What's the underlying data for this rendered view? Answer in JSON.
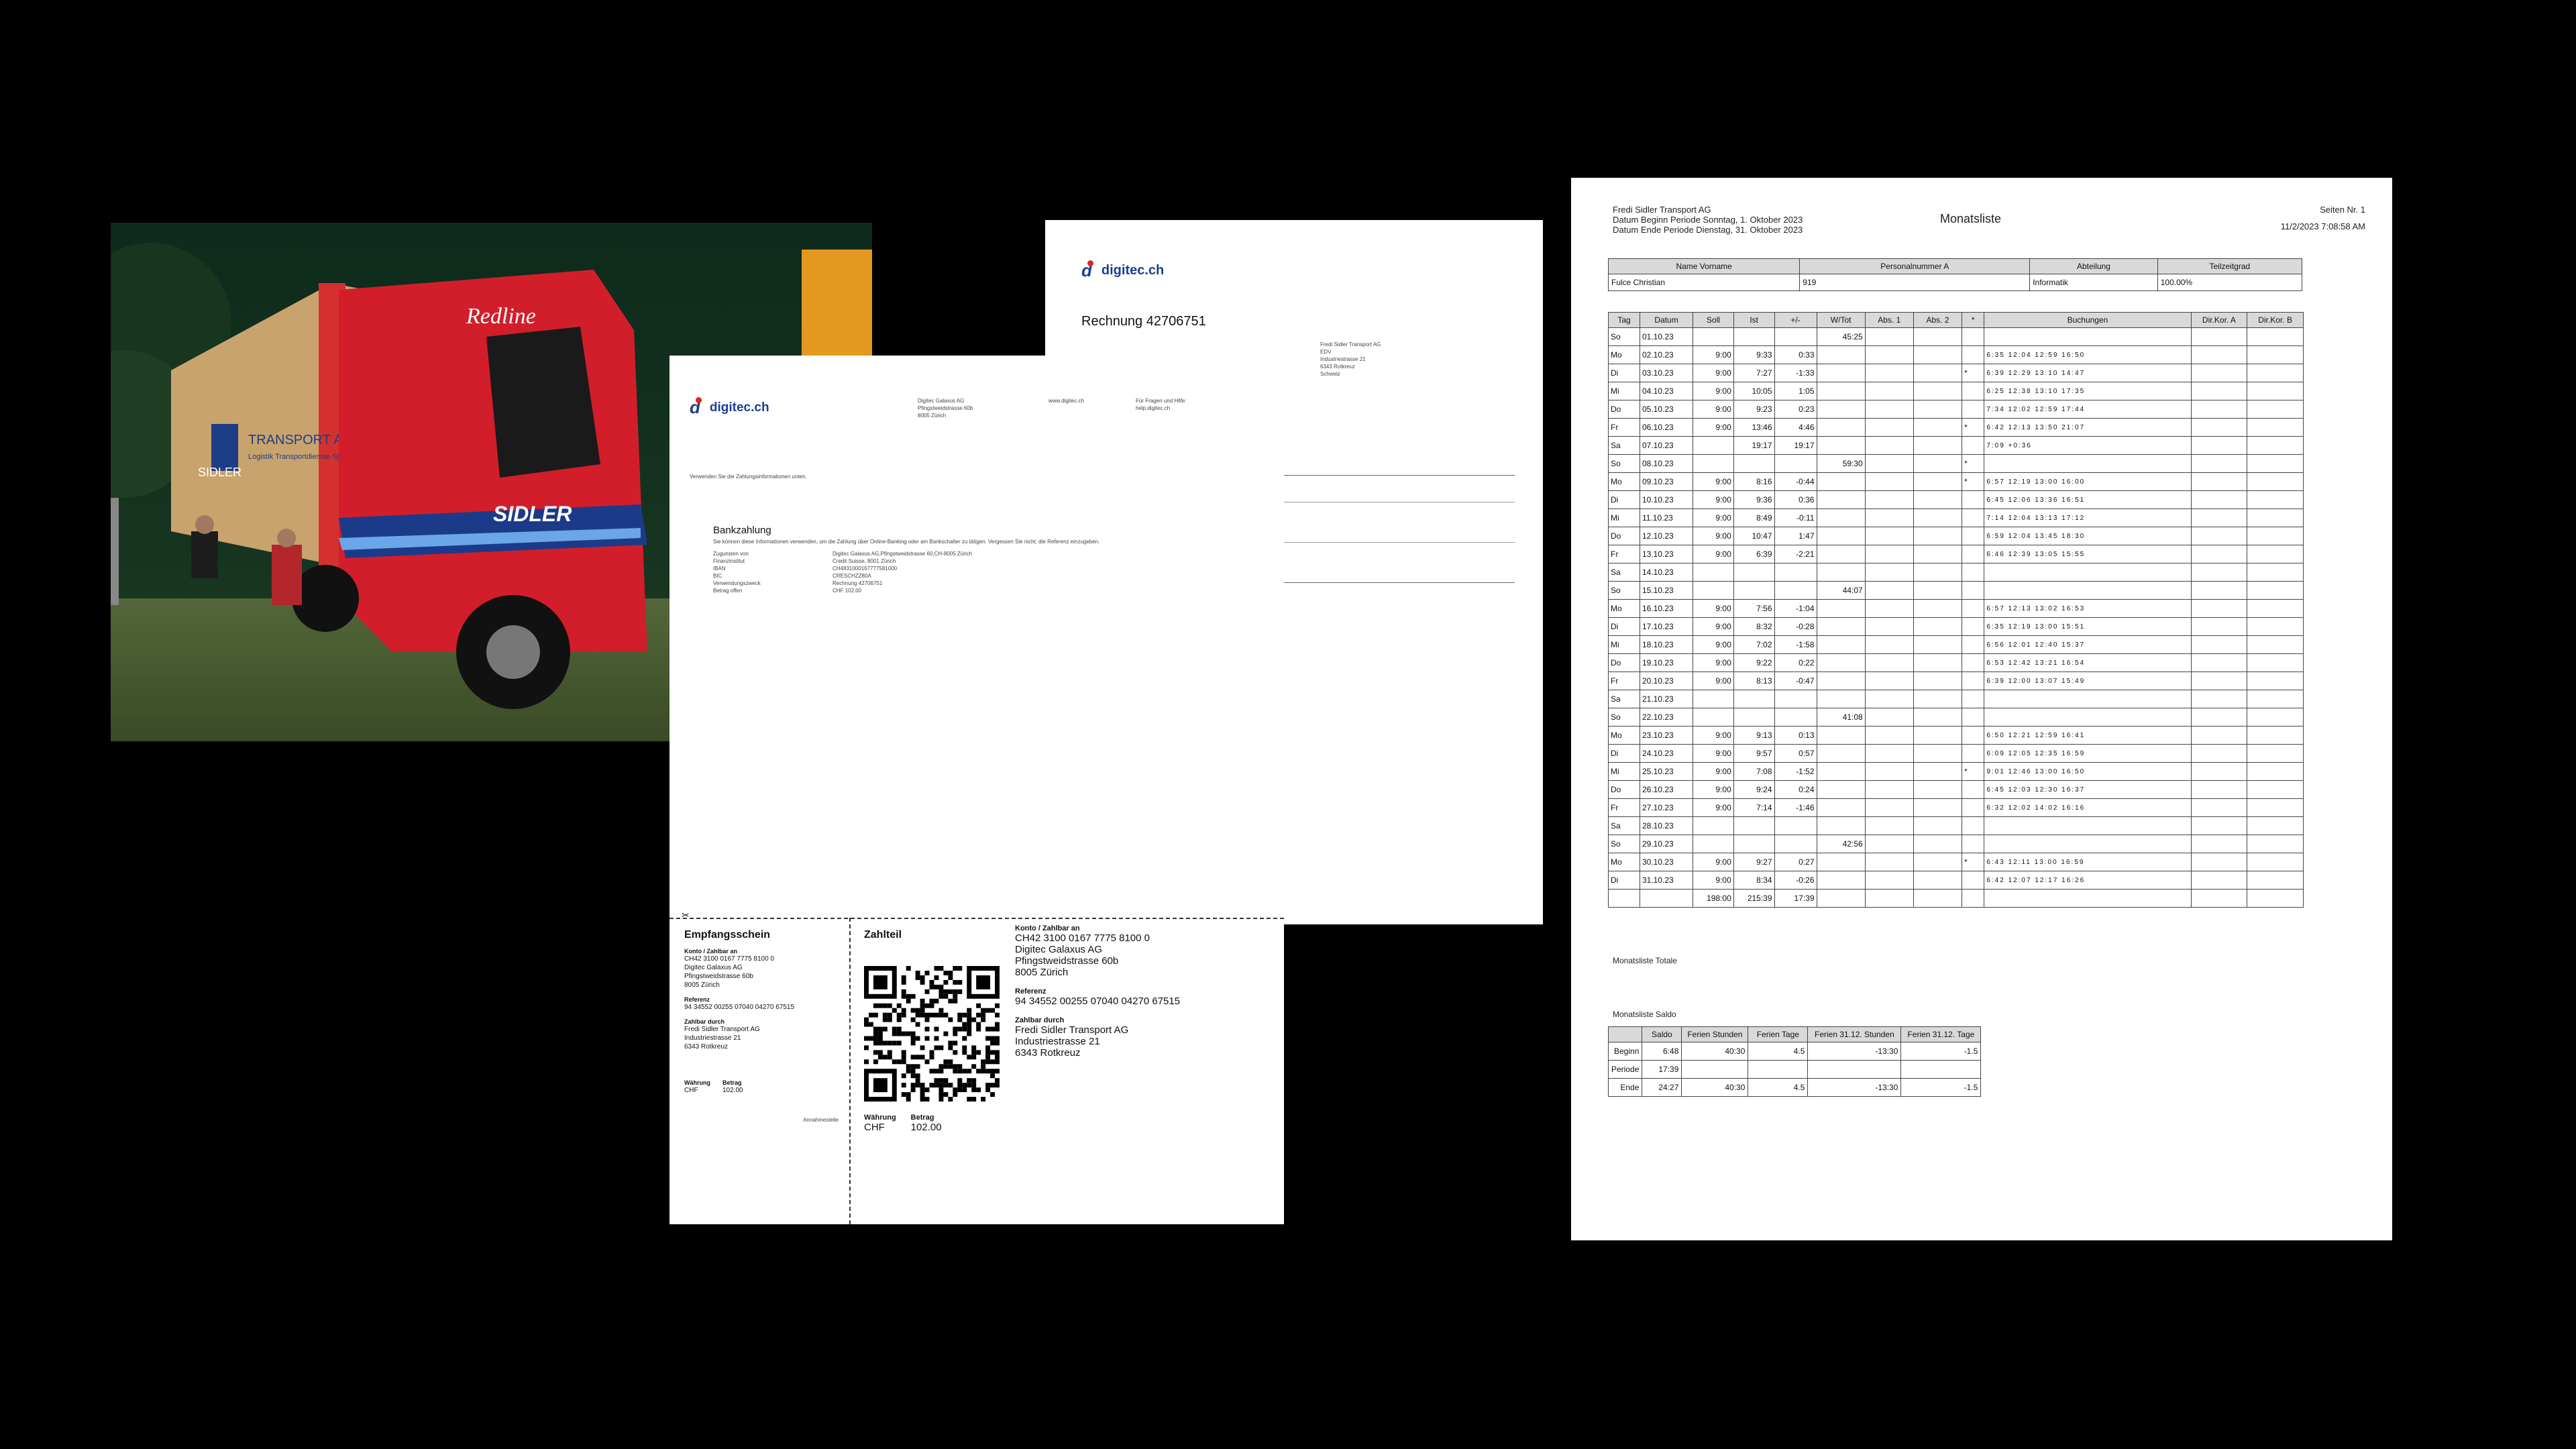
{
  "photo": {
    "truck_script": "Redline",
    "cab_brand": "SIDLER",
    "trailer_brand": "SIDLER",
    "trailer_text": "TRANSPORT AG CHAM",
    "trailer_subtext": "Logistik Transportdienste Spedition"
  },
  "invoice_back": {
    "logo": "digitec.ch",
    "title": "Rechnung 42706751",
    "recipient": [
      "Fredi Sidler Transport AG",
      "EDV",
      "Industriestrasse 21",
      "6343 Rotkreuz",
      "Schweiz"
    ]
  },
  "invoice_front": {
    "logo": "digitec.ch",
    "company": [
      "Digitec Galaxus AG",
      "Pfingstweidstrasse 60b",
      "8005 Zürich"
    ],
    "website": "www.digitec.ch",
    "help": [
      "Für Fragen und Hilfe:",
      "help.digitec.ch"
    ],
    "intro": "Verwenden Sie die Zahlungsinformationen unten.",
    "bank_title": "Bankzahlung",
    "bank_text": "Sie können diese Informationen verwenden, um die Zahlung über Online-Banking oder am Bankschalter zu tätigen. Vergessen Sie nicht, die Referenz einzugeben.",
    "bank_rows": [
      {
        "k": "Zugunsten von",
        "v": "Digitec Galaxus AG,Pfingstweidstrasse 60,CH-8005 Zürich"
      },
      {
        "k": "Finanzinstitut",
        "v": "Credit Suisse, 8001 Zürich"
      },
      {
        "k": "IBAN",
        "v": "CH4831000167777581000"
      },
      {
        "k": "BIC",
        "v": "CRESCHZZ80A"
      },
      {
        "k": "Verwendungszweck",
        "v": "Rechnung 42706751"
      },
      {
        "k": "Betrag offen",
        "v": "CHF 102.00"
      }
    ],
    "receipt": {
      "title": "Empfangsschein",
      "konto_label": "Konto / Zahlbar an",
      "konto": [
        "CH42 3100 0167 7775 8100 0",
        "Digitec Galaxus AG",
        "Pfingstweidstrasse 60b",
        "8005 Zürich"
      ],
      "ref_label": "Referenz",
      "ref": "94 34552 00255 07040 04270 67515",
      "payer_label": "Zahlbar durch",
      "payer": [
        "Fredi Sidler Transport AG",
        "Industriestrasse 21",
        "6343 Rotkreuz"
      ],
      "currency_label": "Währung",
      "amount_label": "Betrag",
      "currency": "CHF",
      "amount": "102.00",
      "annahme": "Annahmestelle"
    },
    "payment": {
      "title": "Zahlteil",
      "konto_label": "Konto / Zahlbar an",
      "konto": [
        "CH42 3100 0167 7775 8100 0",
        "Digitec Galaxus AG",
        "Pfingstweidstrasse 60b",
        "8005 Zürich"
      ],
      "ref_label": "Referenz",
      "ref": "94 34552 00255 07040 04270 67515",
      "payer_label": "Zahlbar durch",
      "payer": [
        "Fredi Sidler Transport AG",
        "Industriestrasse 21",
        "6343 Rotkreuz"
      ],
      "currency_label": "Währung",
      "amount_label": "Betrag",
      "currency": "CHF",
      "amount": "102.00"
    }
  },
  "monatsliste": {
    "company": "Fredi Sidler Transport AG",
    "period_begin": "Datum Beginn Periode Sonntag, 1. Oktober 2023",
    "period_end": "Datum Ende Periode Dienstag, 31. Oktober 2023",
    "title": "Monatsliste",
    "page": "Seiten Nr. 1",
    "printed": "11/2/2023 7:08:58 AM",
    "person_headers": [
      "Name Vorname",
      "Personalnummer A",
      "Abteilung",
      "Teilzeitgrad"
    ],
    "person": [
      "Fulce Christian",
      "919",
      "Informatik",
      "100.00%"
    ],
    "day_headers": [
      "Tag",
      "Datum",
      "Soll",
      "Ist",
      "+/-",
      "W/Tot",
      "Abs. 1",
      "Abs. 2",
      "*",
      "Buchungen",
      "Dir.Kor. A",
      "Dir.Kor. B"
    ],
    "days": [
      [
        "So",
        "01.10.23",
        "",
        "",
        "",
        "45:25",
        "",
        "",
        "",
        "",
        "",
        ""
      ],
      [
        "Mo",
        "02.10.23",
        "9:00",
        "9:33",
        "0:33",
        "",
        "",
        "",
        "",
        "6:35  12:04  12:59  16:50",
        "",
        ""
      ],
      [
        "Di",
        "03.10.23",
        "9:00",
        "7:27",
        "-1:33",
        "",
        "",
        "",
        "*",
        "6:39  12:29  13:10  14:47",
        "",
        ""
      ],
      [
        "Mi",
        "04.10.23",
        "9:00",
        "10:05",
        "1:05",
        "",
        "",
        "",
        "",
        "6:25  12:38  13:10  17:35",
        "",
        ""
      ],
      [
        "Do",
        "05.10.23",
        "9:00",
        "9:23",
        "0:23",
        "",
        "",
        "",
        "",
        "7:34  12:02  12:59  17:44",
        "",
        ""
      ],
      [
        "Fr",
        "06.10.23",
        "9:00",
        "13:46",
        "4:46",
        "",
        "",
        "",
        "*",
        "6:42  12:13  13:50  21:07",
        "",
        ""
      ],
      [
        "Sa",
        "07.10.23",
        "",
        "19:17",
        "19:17",
        "",
        "",
        "",
        "",
        "7:09  +0:36",
        "",
        ""
      ],
      [
        "So",
        "08.10.23",
        "",
        "",
        "",
        "59:30",
        "",
        "",
        "*",
        "",
        "",
        ""
      ],
      [
        "Mo",
        "09.10.23",
        "9:00",
        "8:16",
        "-0:44",
        "",
        "",
        "",
        "*",
        "6:57  12:19  13:00  16:00",
        "",
        ""
      ],
      [
        "Di",
        "10.10.23",
        "9:00",
        "9:36",
        "0:36",
        "",
        "",
        "",
        "",
        "6:45  12:06  13:36  16:51",
        "",
        ""
      ],
      [
        "Mi",
        "11.10.23",
        "9:00",
        "8:49",
        "-0:11",
        "",
        "",
        "",
        "",
        "7:14  12:04  13:13  17:12",
        "",
        ""
      ],
      [
        "Do",
        "12.10.23",
        "9:00",
        "10:47",
        "1:47",
        "",
        "",
        "",
        "",
        "6:59  12:04  13:45  18:30",
        "",
        ""
      ],
      [
        "Fr",
        "13.10.23",
        "9:00",
        "6:39",
        "-2:21",
        "",
        "",
        "",
        "",
        "6:46  12:39  13:05  15:55",
        "",
        ""
      ],
      [
        "Sa",
        "14.10.23",
        "",
        "",
        "",
        "",
        "",
        "",
        "",
        "",
        "",
        ""
      ],
      [
        "So",
        "15.10.23",
        "",
        "",
        "",
        "44:07",
        "",
        "",
        "",
        "",
        "",
        ""
      ],
      [
        "Mo",
        "16.10.23",
        "9:00",
        "7:56",
        "-1:04",
        "",
        "",
        "",
        "",
        "6:57  12:13  13:02  16:53",
        "",
        ""
      ],
      [
        "Di",
        "17.10.23",
        "9:00",
        "8:32",
        "-0:28",
        "",
        "",
        "",
        "",
        "6:35  12:19  13:00  15:51",
        "",
        ""
      ],
      [
        "Mi",
        "18.10.23",
        "9:00",
        "7:02",
        "-1:58",
        "",
        "",
        "",
        "",
        "6:56  12:01  12:40  15:37",
        "",
        ""
      ],
      [
        "Do",
        "19.10.23",
        "9:00",
        "9:22",
        "0:22",
        "",
        "",
        "",
        "",
        "6:53  12:42  13:21  16:54",
        "",
        ""
      ],
      [
        "Fr",
        "20.10.23",
        "9:00",
        "8:13",
        "-0:47",
        "",
        "",
        "",
        "",
        "6:39  12:00  13:07  15:49",
        "",
        ""
      ],
      [
        "Sa",
        "21.10.23",
        "",
        "",
        "",
        "",
        "",
        "",
        "",
        "",
        "",
        ""
      ],
      [
        "So",
        "22.10.23",
        "",
        "",
        "",
        "41:08",
        "",
        "",
        "",
        "",
        "",
        ""
      ],
      [
        "Mo",
        "23.10.23",
        "9:00",
        "9:13",
        "0:13",
        "",
        "",
        "",
        "",
        "6:50  12:21  12:59  16:41",
        "",
        ""
      ],
      [
        "Di",
        "24.10.23",
        "9:00",
        "9:57",
        "0:57",
        "",
        "",
        "",
        "",
        "6:09  12:05  12:35  16:59",
        "",
        ""
      ],
      [
        "Mi",
        "25.10.23",
        "9:00",
        "7:08",
        "-1:52",
        "",
        "",
        "",
        "*",
        "9:01  12:46  13:00  16:50",
        "",
        ""
      ],
      [
        "Do",
        "26.10.23",
        "9:00",
        "9:24",
        "0:24",
        "",
        "",
        "",
        "",
        "6:45  12:03  12:30  16:37",
        "",
        ""
      ],
      [
        "Fr",
        "27.10.23",
        "9:00",
        "7:14",
        "-1:46",
        "",
        "",
        "",
        "",
        "6:32  12:02  14:02  16:16",
        "",
        ""
      ],
      [
        "Sa",
        "28.10.23",
        "",
        "",
        "",
        "",
        "",
        "",
        "",
        "",
        "",
        ""
      ],
      [
        "So",
        "29.10.23",
        "",
        "",
        "",
        "42:56",
        "",
        "",
        "",
        "",
        "",
        ""
      ],
      [
        "Mo",
        "30.10.23",
        "9:00",
        "9:27",
        "0:27",
        "",
        "",
        "",
        "*",
        "6:43  12:11  13:00  16:59",
        "",
        ""
      ],
      [
        "Di",
        "31.10.23",
        "9:00",
        "8:34",
        "-0:26",
        "",
        "",
        "",
        "",
        "6:42  12:07  12:17  16:26",
        "",
        ""
      ]
    ],
    "totals": [
      "",
      "",
      "198:00",
      "215:39",
      "17:39",
      "",
      "",
      "",
      "",
      "",
      "",
      ""
    ],
    "totals_label": "Monatsliste Totale",
    "saldo_label": "Monatsliste Saldo",
    "saldo_headers": [
      "",
      "Saldo",
      "Ferien Stunden",
      "Ferien Tage",
      "Ferien 31.12. Stunden",
      "Ferien 31.12. Tage"
    ],
    "saldo_rows": [
      [
        "Beginn",
        "6:48",
        "40:30",
        "4.5",
        "-13:30",
        "-1.5"
      ],
      [
        "Periode",
        "17:39",
        "",
        "",
        "",
        ""
      ],
      [
        "Ende",
        "24:27",
        "40:30",
        "4.5",
        "-13:30",
        "-1.5"
      ]
    ]
  }
}
